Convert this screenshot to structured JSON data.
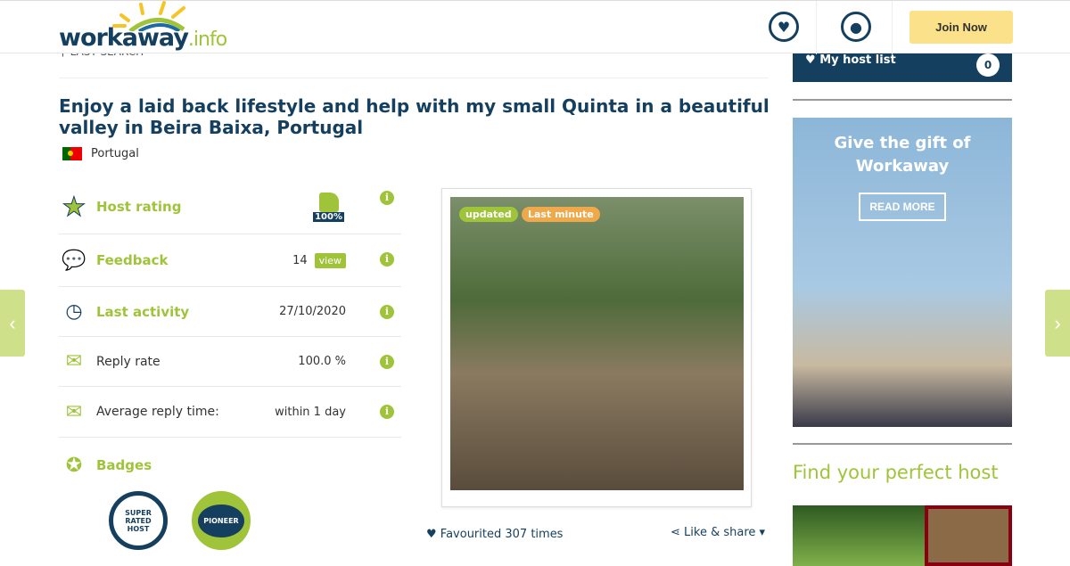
{
  "header": {
    "logo_text": "workaway",
    "logo_suffix": ".info",
    "favourites_icon": "heart-icon",
    "account_icon": "user-icon",
    "join_label": "Join Now"
  },
  "last_search": "LAST SEARCH",
  "listing": {
    "title": "Enjoy a laid back lifestyle and help with my small Quinta in a beautiful valley in Beira Baixa, Portugal",
    "country": "Portugal",
    "stats": [
      {
        "label": "Host rating",
        "value": "100%"
      },
      {
        "label": "Feedback",
        "value": "14",
        "action": "view"
      },
      {
        "label": "Last activity",
        "value": "27/10/2020"
      },
      {
        "label": "Reply rate",
        "value": "100.0 %"
      },
      {
        "label": "Average reply time:",
        "value": "within 1 day"
      },
      {
        "label": "Badges"
      }
    ],
    "badges": [
      "SUPER RATED HOST",
      "PIONEER"
    ],
    "photo_tags": [
      "updated",
      "Last minute"
    ],
    "favourited": "Favourited 307 times",
    "share": "Like & share"
  },
  "sidebar": {
    "host_list_label": "My host list",
    "host_list_count": "0",
    "gift_title": "Give the gift of Workaway",
    "gift_button": "READ MORE",
    "find_title": "Find your perfect host"
  },
  "colors": {
    "navy": "#143f5e",
    "green": "#9fc43a",
    "yellow": "#fbe28a"
  }
}
